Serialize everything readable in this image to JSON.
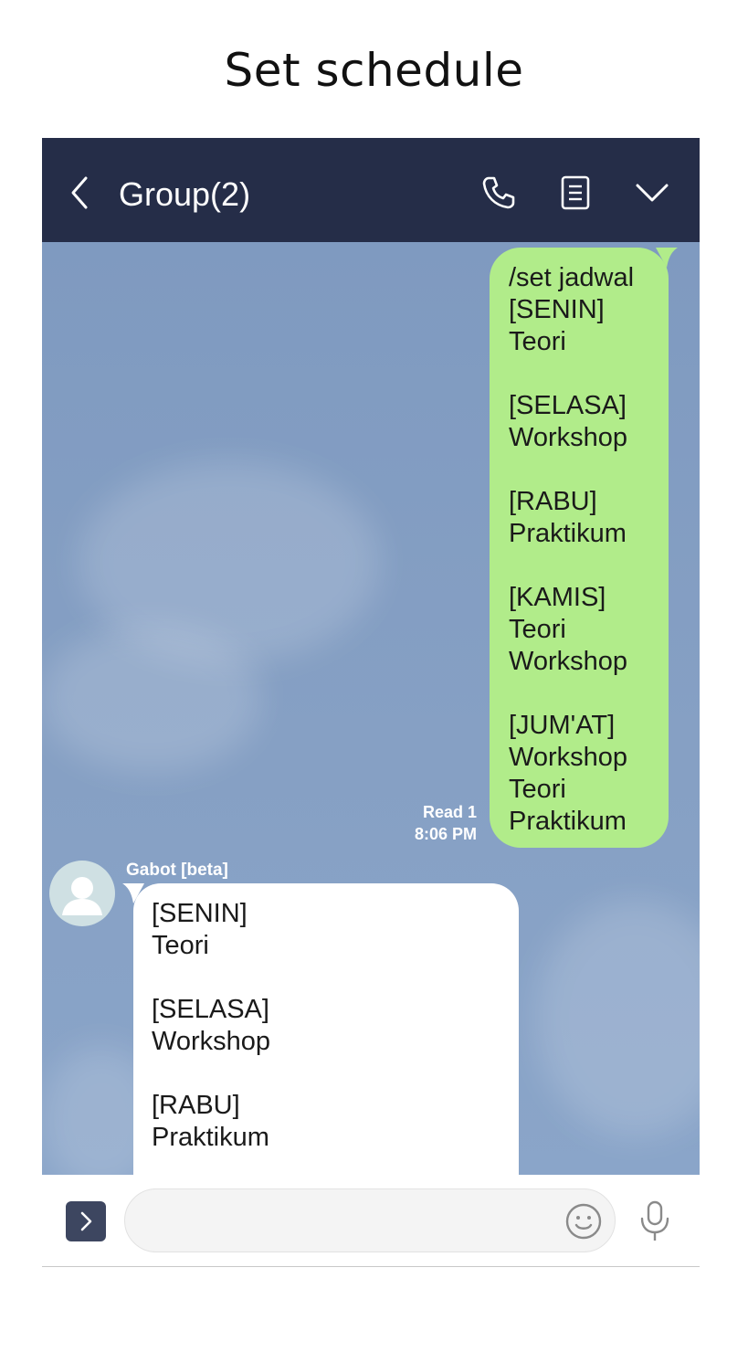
{
  "page": {
    "title": "Set schedule"
  },
  "header": {
    "chat_title": "Group(2)"
  },
  "messages": {
    "outgoing": {
      "text": "/set jadwal\n[SENIN]\nTeori\n\n[SELASA]\nWorkshop\n\n[RABU]\nPraktikum\n\n[KAMIS]\nTeori\nWorkshop\n\n[JUM'AT]\nWorkshop\nTeori\nPraktikum",
      "read_status": "Read 1",
      "time": "8:06 PM",
      "bubble_color": "#b1ec8a"
    },
    "incoming": {
      "sender": "Gabot [beta]",
      "text": "[SENIN]\nTeori\n\n[SELASA]\nWorkshop\n\n[RABU]\nPraktikum",
      "bubble_color": "#ffffff"
    }
  },
  "input": {
    "value": "",
    "placeholder": ""
  },
  "icons": {
    "back": "chevron-left-icon",
    "call": "phone-icon",
    "notes": "notes-icon",
    "menu": "chevron-down-icon",
    "expand": "chevron-right-icon",
    "emoji": "emoji-icon",
    "mic": "microphone-icon"
  },
  "colors": {
    "header_bg": "#252d48",
    "chat_bg": "#86a0c4",
    "expand_button": "#3d4660"
  }
}
